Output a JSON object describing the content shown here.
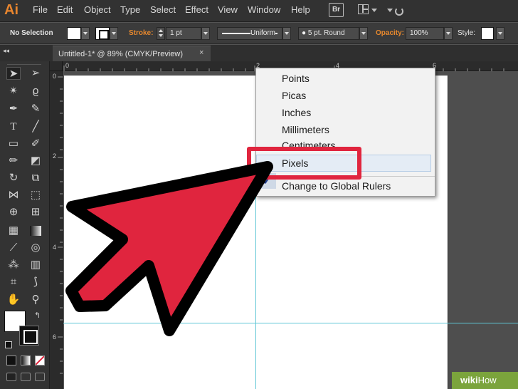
{
  "app": {
    "logo": "Ai",
    "badge": "Br"
  },
  "menu": [
    "File",
    "Edit",
    "Object",
    "Type",
    "Select",
    "Effect",
    "View",
    "Window",
    "Help"
  ],
  "control_bar": {
    "selection_label": "No Selection",
    "stroke_label": "Stroke:",
    "stroke_weight": "1 pt",
    "profile": "Uniform",
    "brush": "5 pt. Round",
    "opacity_label": "Opacity:",
    "opacity_value": "100%",
    "style_label": "Style:"
  },
  "document_tab": {
    "title": "Untitled-1* @ 89% (CMYK/Preview)",
    "close": "×"
  },
  "rulers": {
    "top": [
      "0",
      "2",
      "4",
      "6"
    ],
    "left": [
      "0",
      "2",
      "4",
      "6"
    ]
  },
  "tools": [
    "selection-tool",
    "direct-selection-tool",
    "magic-wand-tool",
    "lasso-tool",
    "pen-tool",
    "curvature-tool",
    "type-tool",
    "line-tool",
    "rectangle-tool",
    "paintbrush-tool",
    "shaper-tool",
    "eraser-tool",
    "rotate-tool",
    "scale-tool",
    "width-tool",
    "free-transform-tool",
    "shape-builder-tool",
    "perspective-grid-tool",
    "mesh-tool",
    "gradient-tool",
    "eyedropper-tool",
    "blend-tool",
    "symbol-sprayer-tool",
    "column-graph-tool",
    "artboard-tool",
    "slice-tool",
    "hand-tool",
    "zoom-tool"
  ],
  "context_menu": {
    "items": [
      "Points",
      "Picas",
      "Inches",
      "Millimeters",
      "Centimeters",
      "Pixels",
      "Change to Global Rulers"
    ],
    "checked_item": "Inches",
    "highlighted_item": "Pixels"
  },
  "colors": {
    "accent_red": "#e0253e",
    "guide": "#5fc7d6",
    "menu_bg": "#f2f2f2",
    "watermark_green": "#7ba43c"
  },
  "watermark": {
    "bold": "wiki",
    "normal": "How"
  }
}
